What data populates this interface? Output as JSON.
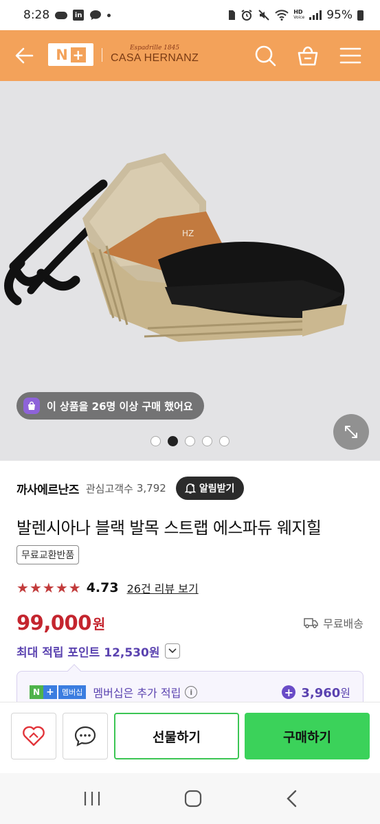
{
  "status_bar": {
    "time": "8:28",
    "battery": "95%",
    "hd_label": "HD",
    "voice_label": "Voice",
    "linkedin_label": "in"
  },
  "header": {
    "logo_n": "N",
    "logo_plus": "+",
    "brand_script": "Espadrille 1845",
    "brand_name": "CASA HERNANZ",
    "bg_color": "#f3a25a"
  },
  "hero": {
    "purchase_notice": "이 상품을 26명 이상 구매 했어요",
    "slide_count": 5,
    "active_slide": 2
  },
  "product": {
    "seller": "까사에르난즈",
    "interest_label": "관심고객수",
    "interest_count": "3,792",
    "alarm_button": "알림받기",
    "title": "발렌시아나 블랙 발목 스트랩 에스파듀 웨지힐",
    "tag": "무료교환반품",
    "rating": "4.73",
    "stars_count": 5,
    "review_link": "26건 리뷰 보기",
    "price": "99,000",
    "price_unit": "원",
    "shipping": "무료배송",
    "max_points": "최대 적립 포인트 12,530원"
  },
  "membership": {
    "npay_n": "N",
    "npay_plus": "+",
    "npay_label": "멤버십",
    "text": "멤버십은 추가 적립",
    "info_icon": "i",
    "points": "3,960",
    "points_unit": "원"
  },
  "bottom_bar": {
    "gift_label": "선물하기",
    "buy_label": "구매하기",
    "buy_color": "#3bd25a"
  }
}
